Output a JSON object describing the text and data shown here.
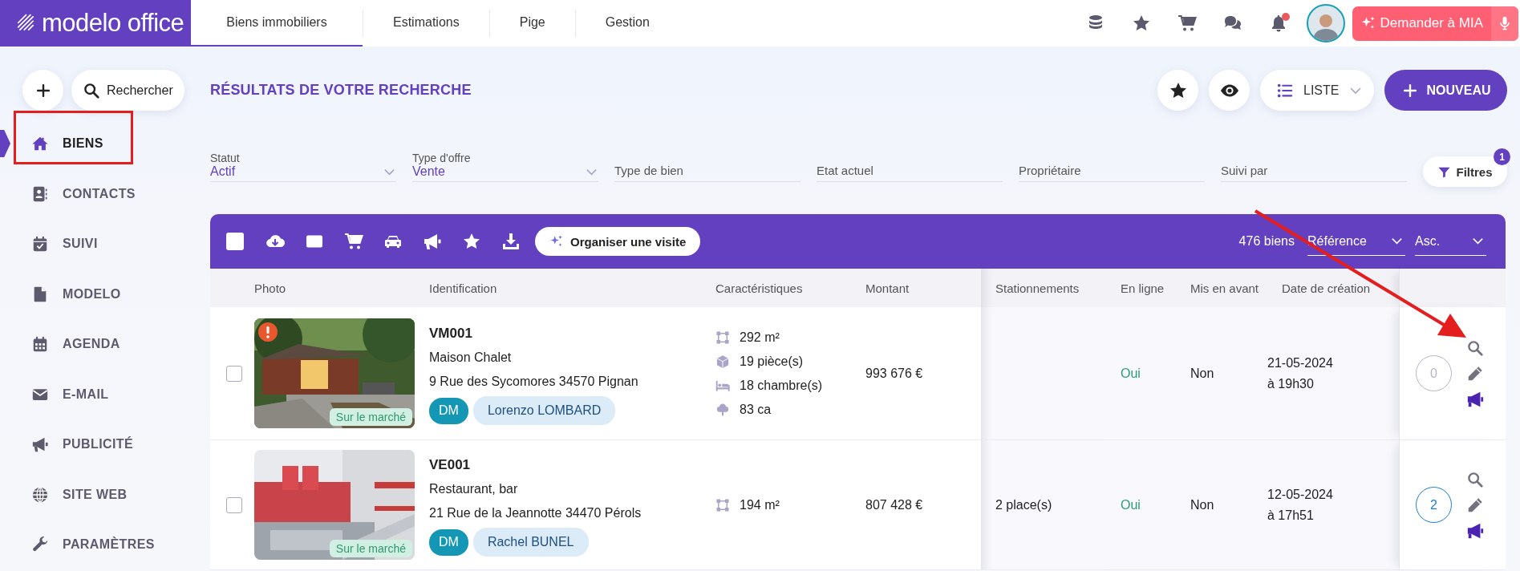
{
  "logo": {
    "text": "modelo office"
  },
  "nav_tabs": [
    {
      "label": "Biens immobiliers",
      "selected": true
    },
    {
      "label": "Estimations",
      "selected": false
    },
    {
      "label": "Pige",
      "selected": false
    },
    {
      "label": "Gestion",
      "selected": false
    }
  ],
  "header_icons": [
    {
      "kind": "coins",
      "has_notification": false
    },
    {
      "kind": "star",
      "has_notification": false
    },
    {
      "kind": "cart",
      "has_notification": false
    },
    {
      "kind": "chat",
      "has_notification": false
    },
    {
      "kind": "bell",
      "has_notification": true
    }
  ],
  "mia_button": {
    "label": "Demander à MIA"
  },
  "quick_actions": {
    "search_label": "Rechercher"
  },
  "sidebar": {
    "items": [
      {
        "label": "BIENS",
        "selected": true
      },
      {
        "label": "CONTACTS",
        "selected": false
      },
      {
        "label": "SUIVI",
        "selected": false
      },
      {
        "label": "MODELO",
        "selected": false
      },
      {
        "label": "AGENDA",
        "selected": false
      },
      {
        "label": "E-MAIL",
        "selected": false
      },
      {
        "label": "PUBLICITÉ",
        "selected": false
      },
      {
        "label": "SITE WEB",
        "selected": false
      },
      {
        "label": "PARAMÈTRES",
        "selected": false
      }
    ]
  },
  "page_title": "RÉSULTATS DE VOTRE RECHERCHE",
  "view_buttons": [
    {
      "kind": "star"
    },
    {
      "kind": "eye"
    }
  ],
  "display_mode": {
    "label": "LISTE"
  },
  "new_button": {
    "label": "NOUVEAU"
  },
  "filters": [
    {
      "label": "Statut",
      "value": "Actif"
    },
    {
      "label": "Type d'offre",
      "value": "Vente"
    },
    {
      "placeholder": "Type de bien"
    },
    {
      "placeholder": "Etat actuel"
    },
    {
      "placeholder": "Propriétaire"
    },
    {
      "placeholder": "Suivi par"
    }
  ],
  "filters_button": {
    "label": "Filtres",
    "badge": "1"
  },
  "toolbar": {
    "select_all": {
      "checked": false
    },
    "tools": [
      {
        "kind": "cloud_download"
      },
      {
        "kind": "email"
      },
      {
        "kind": "cart"
      },
      {
        "kind": "car"
      },
      {
        "kind": "megaphone"
      },
      {
        "kind": "star"
      },
      {
        "kind": "download"
      }
    ],
    "visit_button": "Organiser une visite",
    "count": "476 biens",
    "sort_field": "Référence",
    "sort_order": "Asc."
  },
  "table": {
    "columns": [
      "Photo",
      "Identification",
      "Caractéristiques",
      "Montant",
      "Stationnements",
      "En ligne",
      "Mis en avant",
      "Date de création"
    ],
    "rows": [
      {
        "selected": false,
        "alert": true,
        "status": "Sur le marché",
        "reference": "VM001",
        "type": "Maison Chalet",
        "address": "9 Rue des Sycomores 34570 Pignan",
        "agent_initials": "DM",
        "agent_name": "Lorenzo LOMBARD",
        "features": [
          {
            "kind": "area",
            "text": "292 m²"
          },
          {
            "kind": "rooms",
            "text": "19 pièce(s)"
          },
          {
            "kind": "bedrooms",
            "text": "18 chambre(s)"
          },
          {
            "kind": "land",
            "text": "83 ca"
          }
        ],
        "amount": "993 676 €",
        "online": "Oui",
        "featured": "Non",
        "created_date": "21-05-2024",
        "created_time": "à 19h30",
        "count": "0",
        "count_active": false
      },
      {
        "selected": false,
        "alert": false,
        "status": "Sur le marché",
        "reference": "VE001",
        "type": "Restaurant, bar",
        "address": "21 Rue de la Jeannotte 34470 Pérols",
        "agent_initials": "DM",
        "agent_name": "Rachel BUNEL",
        "features": [
          {
            "kind": "area",
            "text": "194 m²"
          }
        ],
        "amount": "807 428 €",
        "parking": "2 place(s)",
        "online": "Oui",
        "featured": "Non",
        "created_date": "12-05-2024",
        "created_time": "à 17h51",
        "count": "2",
        "count_active": true
      }
    ]
  }
}
